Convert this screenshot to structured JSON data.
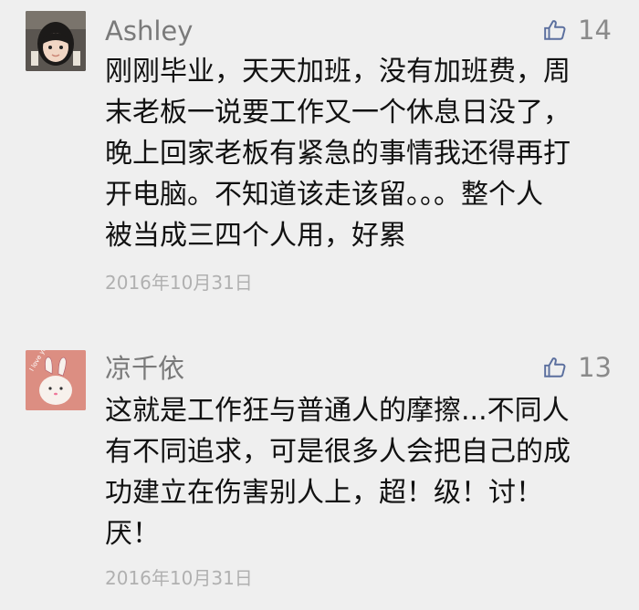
{
  "comments": [
    {
      "name": "Ashley",
      "likes": "14",
      "lines": [
        "刚刚毕业，天天加班，没有加班费，周",
        "末老板一说要工作又一个休息日没了，",
        "晚上回家老板有紧急的事情我还得再打",
        "开电脑。不知道该走该留。。。整个人",
        "被当成三四个人用，好累"
      ],
      "date": "2016年10月31日",
      "avatar_icon": "child-photo-avatar",
      "avatar_bg": "#3b3b3b"
    },
    {
      "name": "凉千依",
      "likes": "13",
      "lines": [
        "这就是工作狂与普通人的摩擦...不同人",
        "有不同追求，可是很多人会把自己的成",
        "功建立在伤害别人上，超！级！讨！",
        "厌！"
      ],
      "date": "2016年10月31日",
      "avatar_icon": "bunny-avatar",
      "avatar_bg": "#d98b80",
      "avatar_text": "I love you"
    }
  ],
  "colors": {
    "background": "#efefef",
    "name": "#7a7a7a",
    "body": "#111111",
    "date": "#b0b0b0",
    "like": "#8a8a8a"
  }
}
